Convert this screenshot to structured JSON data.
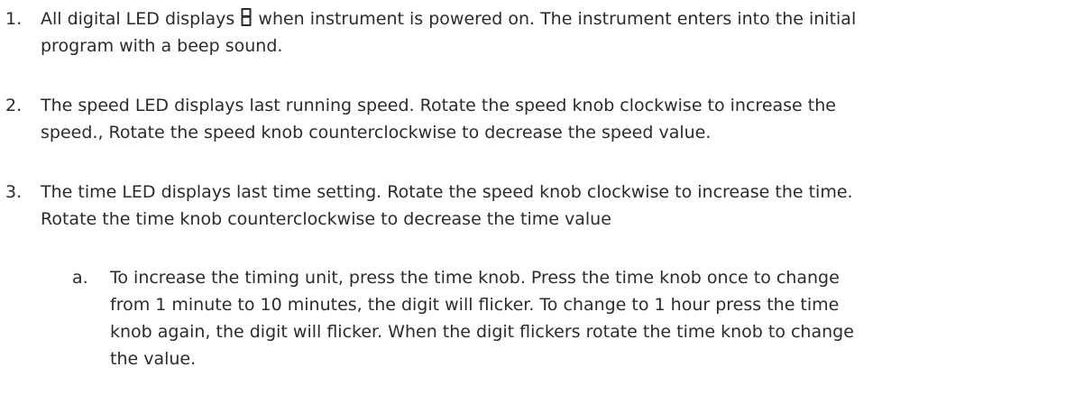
{
  "list": {
    "items": [
      {
        "number": "1.",
        "line1_before_glyph": "All digital LED displays ",
        "glyph": "8",
        "glyph_icon": "seven-segment-8-icon",
        "line1_after_glyph": " when instrument is powered on. The instrument enters into the initial",
        "line2": "program with a beep sound."
      },
      {
        "number": "2.",
        "line1": "The speed LED displays last running speed. Rotate the speed knob clockwise to increase the",
        "line2": "speed., Rotate the speed knob counterclockwise to decrease the speed value."
      },
      {
        "number": "3.",
        "line1": "The time LED displays last time setting. Rotate the speed knob clockwise to increase the time.",
        "line2": "Rotate the time knob counterclockwise to decrease the time value",
        "subitems": [
          {
            "letter": "a.",
            "lines": [
              "To increase the timing unit, press the time knob.  Press the time knob once to change",
              "from 1 minute to 10 minutes, the digit will flicker.  To change to 1 hour press the time",
              "knob again, the digit will flicker.  When the digit flickers rotate the time knob to change",
              "the value."
            ]
          }
        ]
      }
    ]
  }
}
